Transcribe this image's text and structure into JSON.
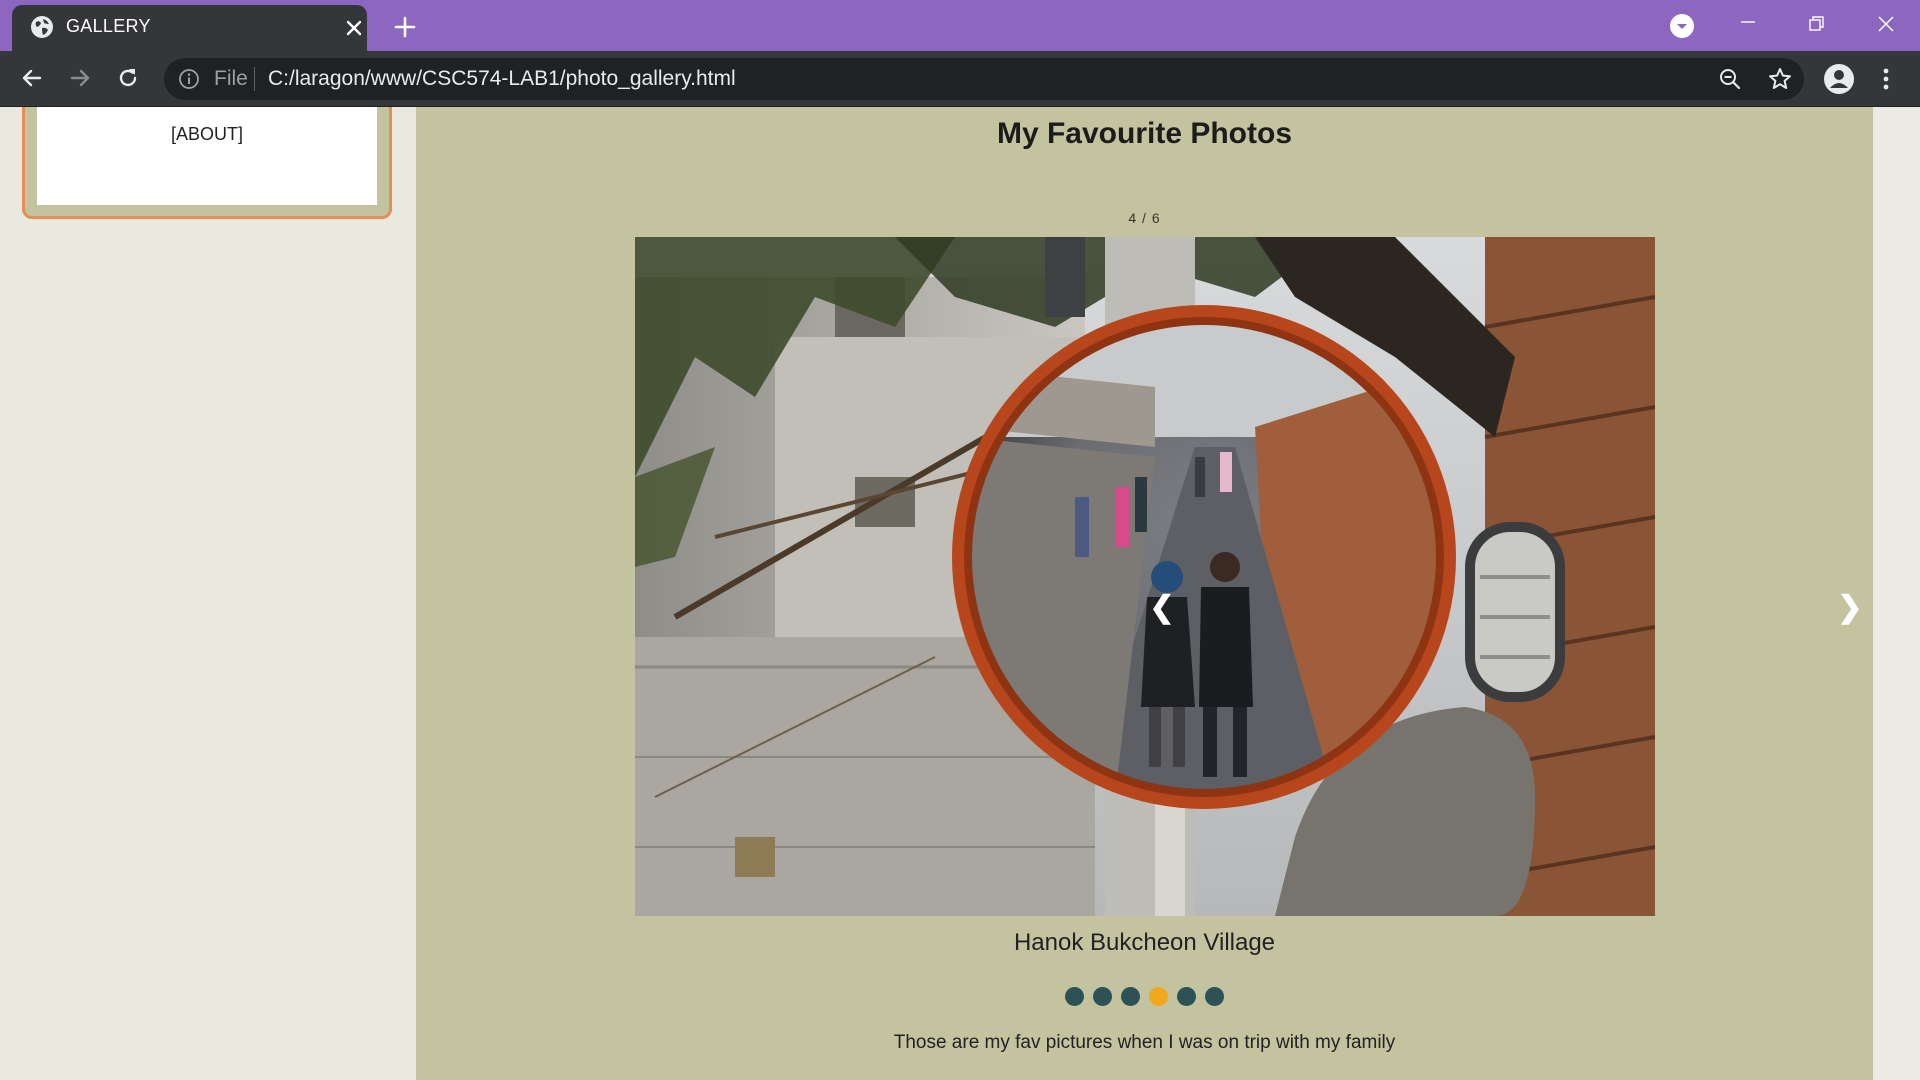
{
  "browser": {
    "tab_title": "GALLERY",
    "omnibox_scheme_label": "File",
    "url": "C:/laragon/www/CSC574-LAB1/photo_gallery.html",
    "titlebar_color": "#8d66c0",
    "toolbar_color": "#35363a"
  },
  "sidebar": {
    "about_label": "[ABOUT]",
    "card_border_color": "#e58e5a"
  },
  "gallery": {
    "title": "My Favourite Photos",
    "counter": "4 / 6",
    "prev_label": "❮",
    "next_label": "❯",
    "caption": "Hanok Bukcheon Village",
    "slide_count": 6,
    "active_slide": 4,
    "description": "Those are my fav pictures when I was on trip with my family",
    "main_bg_color": "#c4c39f",
    "dot_color": "#2d5256",
    "active_dot_color": "#f2a81c"
  }
}
